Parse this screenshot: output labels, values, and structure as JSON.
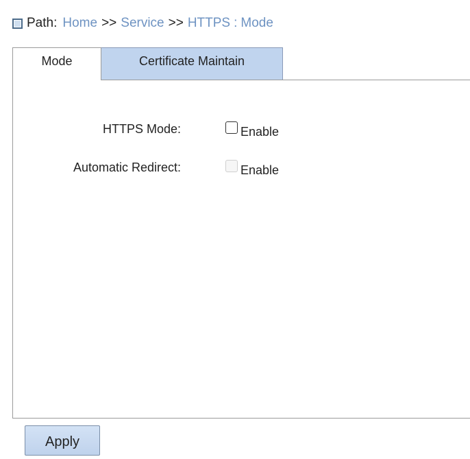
{
  "breadcrumb": {
    "icon": "square-icon",
    "label": "Path:",
    "items": [
      "Home",
      "Service",
      "HTTPS"
    ],
    "separator": ">>",
    "colon": ":",
    "current": "Mode",
    "link_color": "#6e93c2"
  },
  "tabs": [
    {
      "label": "Mode",
      "active": true
    },
    {
      "label": "Certificate Maintain",
      "active": false
    }
  ],
  "tab_inactive_color": "#c0d4ee",
  "form": {
    "https_mode": {
      "label": "HTTPS Mode:",
      "checkbox_label": "Enable",
      "checked": false,
      "disabled": false
    },
    "auto_redirect": {
      "label": "Automatic Redirect:",
      "checkbox_label": "Enable",
      "checked": false,
      "disabled": true
    }
  },
  "actions": {
    "apply_label": "Apply",
    "button_color": "#c8d9f0"
  }
}
